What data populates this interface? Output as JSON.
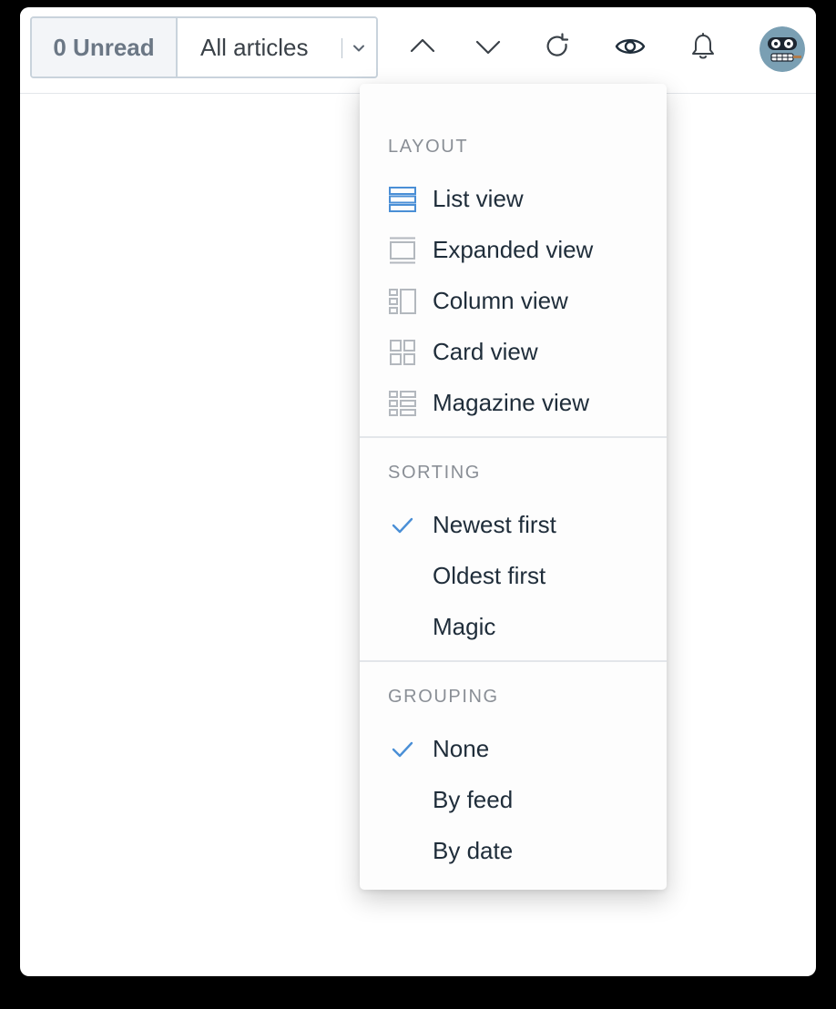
{
  "toolbar": {
    "unread_label": "0 Unread",
    "filter_label": "All articles"
  },
  "menu": {
    "layout": {
      "header": "LAYOUT",
      "items": [
        {
          "label": "List view",
          "icon": "list-view-icon",
          "selected": true
        },
        {
          "label": "Expanded view",
          "icon": "expanded-view-icon",
          "selected": false
        },
        {
          "label": "Column view",
          "icon": "column-view-icon",
          "selected": false
        },
        {
          "label": "Card view",
          "icon": "card-view-icon",
          "selected": false
        },
        {
          "label": "Magazine view",
          "icon": "magazine-view-icon",
          "selected": false
        }
      ]
    },
    "sorting": {
      "header": "SORTING",
      "items": [
        {
          "label": "Newest first",
          "checked": true
        },
        {
          "label": "Oldest first",
          "checked": false
        },
        {
          "label": "Magic",
          "checked": false
        }
      ]
    },
    "grouping": {
      "header": "GROUPING",
      "items": [
        {
          "label": "None",
          "checked": true
        },
        {
          "label": "By feed",
          "checked": false
        },
        {
          "label": "By date",
          "checked": false
        }
      ]
    }
  },
  "colors": {
    "accent": "#4a8fd6",
    "icon_gray": "#b3b8be",
    "text": "#1f2d3a",
    "header_text": "#8a8f96",
    "unread_text": "#6b7785",
    "avatar_bg": "#7a9fb3"
  }
}
